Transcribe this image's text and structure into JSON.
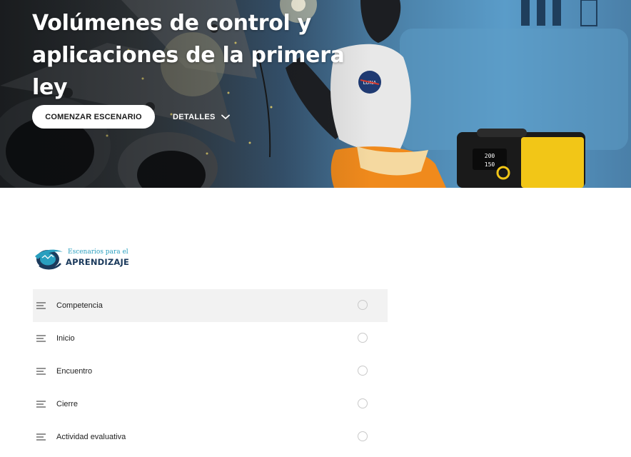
{
  "hero": {
    "title_line1": "Volúmenes de control y",
    "title_line2": "aplicaciones de la primera ley",
    "start_button": "COMENZAR ESCENARIO",
    "details_label": "DETALLES",
    "patch_text": "LUNA",
    "welder_display_top": "200",
    "welder_display_bottom": "150"
  },
  "logo": {
    "small_text": "Escenarios para el",
    "big_text": "APRENDIZAJE",
    "colors": {
      "teal": "#2a9fbf",
      "navy": "#1b3a5c"
    }
  },
  "sections": [
    {
      "label": "Competencia",
      "active": true
    },
    {
      "label": "Inicio",
      "active": false
    },
    {
      "label": "Encuentro",
      "active": false
    },
    {
      "label": "Cierre",
      "active": false
    },
    {
      "label": "Actividad evaluativa",
      "active": false
    }
  ],
  "icons": {
    "chevron": "chevron-down-icon",
    "section": "lines-icon",
    "status": "radio-circle-icon"
  }
}
